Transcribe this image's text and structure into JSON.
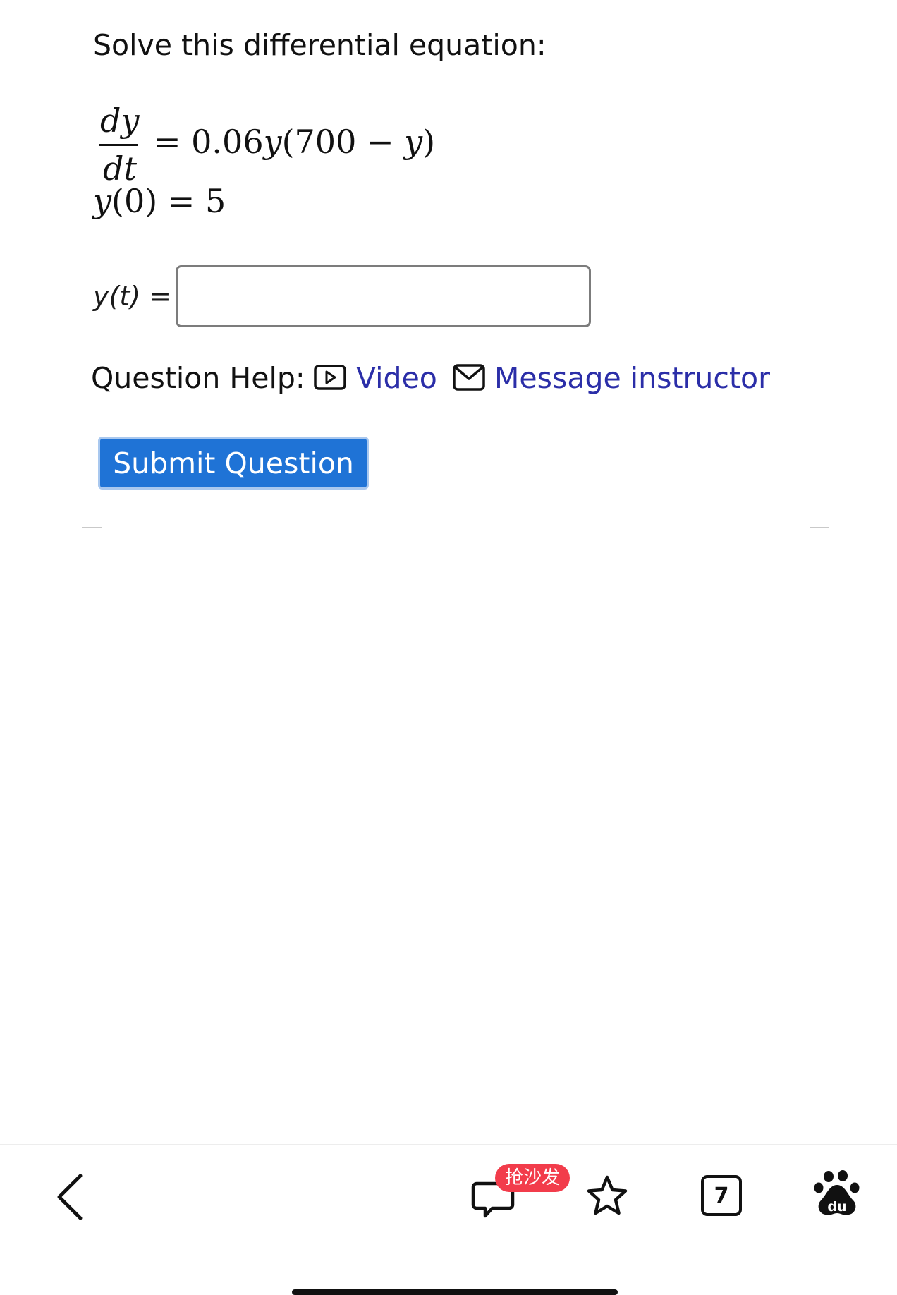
{
  "question": {
    "prompt": "Solve this differential equation:",
    "equation": {
      "numerator": "dy",
      "denominator": "dt",
      "rhs_prefix": "= 0.06",
      "rhs_var": "y",
      "rhs_paren": "(700 − ",
      "rhs_var2": "y",
      "rhs_close": ")",
      "initial_var": "y",
      "initial_rest": "(0) = 5"
    },
    "answer_label": "y(t) =",
    "answer_value": "",
    "answer_placeholder": ""
  },
  "help": {
    "label": "Question Help:",
    "video_label": "Video",
    "message_label": "Message instructor"
  },
  "submit_label": "Submit Question",
  "bottom_bar": {
    "sofa_badge": "抢沙发",
    "tabs_count": "7",
    "badge_color": "#f23c4b"
  },
  "colors": {
    "link": "#2b2ea8",
    "button": "#1f73d6"
  }
}
